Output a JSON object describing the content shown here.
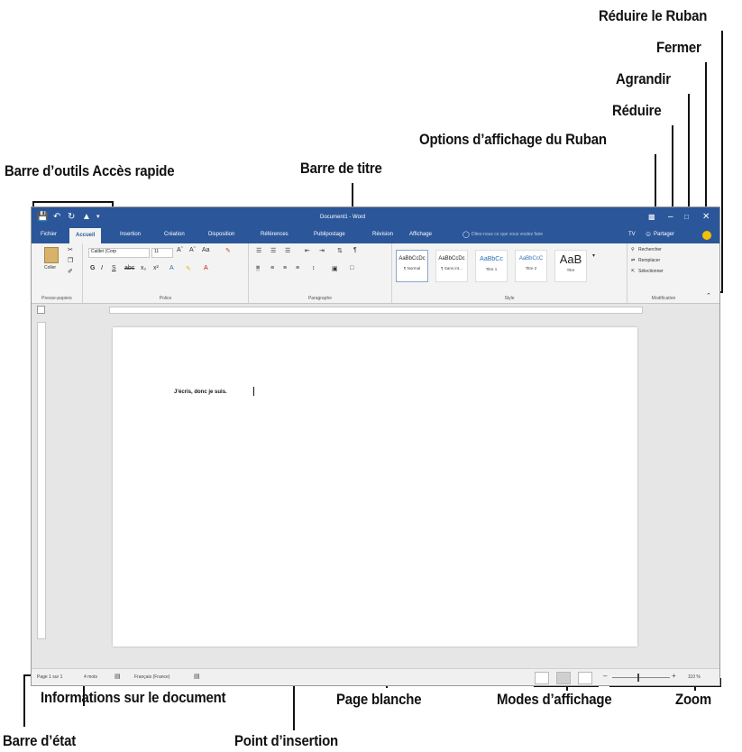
{
  "callouts": {
    "reduire_ruban": "Réduire le Ruban",
    "fermer": "Fermer",
    "agrandir": "Agrandir",
    "reduire": "Réduire",
    "options_affichage": "Options d’affichage du Ruban",
    "barre_outils": "Barre d’outils Accès rapide",
    "barre_titre": "Barre de titre",
    "informations": "Informations sur le document",
    "page_blanche": "Page blanche",
    "modes_affichage": "Modes d’affichage",
    "zoom": "Zoom",
    "barre_etat": "Barre d’état",
    "point_insertion": "Point d’insertion"
  },
  "window": {
    "title": "Document1 - Word",
    "share_label": "Partager",
    "tell_me": "Dites-nous ce que vous voulez faire",
    "account_initials": "TV",
    "tabs": [
      "Fichier",
      "Accueil",
      "Insertion",
      "Création",
      "Disposition",
      "Références",
      "Publipostage",
      "Révision",
      "Affichage"
    ],
    "active_tab": "Accueil",
    "accent_color": "#2b579a"
  },
  "ribbon": {
    "clipboard": {
      "label": "Presse-papiers",
      "paste": "Coller"
    },
    "font": {
      "label": "Police",
      "name": "Calibri (Corp",
      "size": "11",
      "bold": "G",
      "italic": "I",
      "underline": "S"
    },
    "paragraph": {
      "label": "Paragraphe"
    },
    "styles": {
      "label": "Style",
      "items": [
        {
          "preview": "AaBbCcDc",
          "name": "¶ Normal"
        },
        {
          "preview": "AaBbCcDc",
          "name": "¶ Sans int..."
        },
        {
          "preview": "AaBbCc",
          "name": "Titre 1"
        },
        {
          "preview": "AaBbCcC",
          "name": "Titre 2"
        },
        {
          "preview": "AaB",
          "name": "Titre"
        }
      ]
    },
    "editing": {
      "label": "Modification",
      "find": "Rechercher",
      "replace": "Remplacer",
      "select": "Sélectionner"
    }
  },
  "document": {
    "text": "J’écris, donc je suis."
  },
  "status": {
    "page": "Page 1 sur 1",
    "words": "4 mots",
    "language": "Français (France)",
    "zoom": "110 %"
  }
}
